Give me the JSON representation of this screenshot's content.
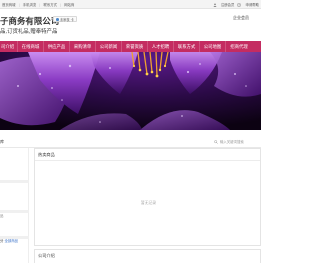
{
  "topbar": {
    "links": [
      "首页商城",
      "手机浏览",
      "联系方式",
      "网站商"
    ],
    "right_links": [
      "注册会员",
      "申请帮助"
    ]
  },
  "header": {
    "company_name": "子商务有限公司",
    "verified_label": "未审核 卡",
    "business": "品,订货礼品,赠奉特产品",
    "vip_label": "企业会员"
  },
  "nav": {
    "items": [
      "司介绍",
      "在线商城",
      "供应产品",
      "采购清单",
      "公司新闻",
      "荣誉资质",
      "人才招聘",
      "联系方式",
      "公司地图",
      "招商代理"
    ]
  },
  "banner": {
    "accent": "#c42c61"
  },
  "subbar": {
    "left_title": "库",
    "search_placeholder": "输入关键词搜索"
  },
  "leftcol": {
    "label_a": "品",
    "link_prefix": "分",
    "link_blue": "全部商品"
  },
  "panel": {
    "title": "热卖商品",
    "empty_text": "暂无记录"
  },
  "intro": {
    "title": "公司介绍"
  }
}
